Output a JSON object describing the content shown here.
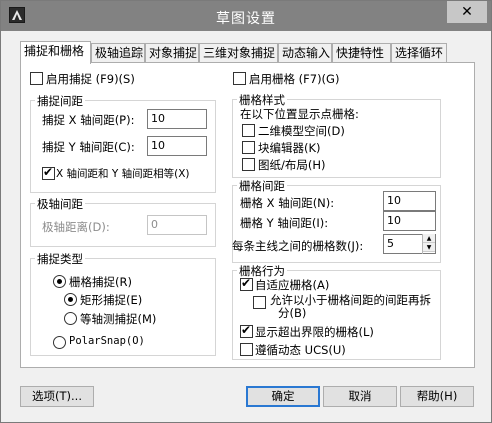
{
  "window": {
    "title": "草图设置",
    "close_glyph": "✕"
  },
  "tabs": [
    {
      "label": "捕捉和栅格"
    },
    {
      "label": "极轴追踪"
    },
    {
      "label": "对象捕捉"
    },
    {
      "label": "三维对象捕捉"
    },
    {
      "label": "动态输入"
    },
    {
      "label": "快捷特性"
    },
    {
      "label": "选择循环"
    }
  ],
  "snap": {
    "enable_label": "启用捕捉 (F9)(S)",
    "enable_checked": false,
    "spacing_group": "捕捉间距",
    "x_label": "捕捉 X 轴间距(P):",
    "x_value": "10",
    "y_label": "捕捉 Y 轴间距(C):",
    "y_value": "10",
    "equal_label": "X 轴间距和 Y 轴间距相等(X)",
    "equal_checked": true
  },
  "polar": {
    "group": "极轴间距",
    "distance_label": "极轴距离(D):",
    "distance_value": "0"
  },
  "snap_type": {
    "group": "捕捉类型",
    "grid_snap_label": "栅格捕捉(R)",
    "rect_snap_label": "矩形捕捉(E)",
    "iso_snap_label": "等轴测捕捉(M)",
    "polarsnap_label": "PolarSnap(O)",
    "selected": "grid_snap",
    "sub_selected": "rect_snap"
  },
  "grid": {
    "enable_label": "启用栅格 (F7)(G)",
    "enable_checked": false,
    "style_group": "栅格样式",
    "style_intro": "在以下位置显示点栅格:",
    "model_space_label": "二维模型空间(D)",
    "block_editor_label": "块编辑器(K)",
    "sheet_layout_label": "图纸/布局(H)",
    "spacing_group": "栅格间距",
    "x_label": "栅格 X 轴间距(N):",
    "x_value": "10",
    "y_label": "栅格 Y 轴间距(I):",
    "y_value": "10",
    "major_label": "每条主线之间的栅格数(J):",
    "major_value": "5",
    "behavior_group": "栅格行为",
    "adaptive_label": "自适应栅格(A)",
    "adaptive_checked": true,
    "subdivide_label_1": "允许以小于栅格间距的间距再拆",
    "subdivide_label_2": "分(B)",
    "subdivide_checked": false,
    "beyond_limits_label": "显示超出界限的栅格(L)",
    "beyond_limits_checked": true,
    "follow_ucs_label": "遵循动态 UCS(U)",
    "follow_ucs_checked": false
  },
  "buttons": {
    "options": "选项(T)...",
    "ok": "确定",
    "cancel": "取消",
    "help": "帮助(H)"
  },
  "icons": {
    "app": "autocad-app-icon",
    "close": "close-icon",
    "spin_up": "spin-up-icon",
    "spin_down": "spin-down-icon"
  }
}
